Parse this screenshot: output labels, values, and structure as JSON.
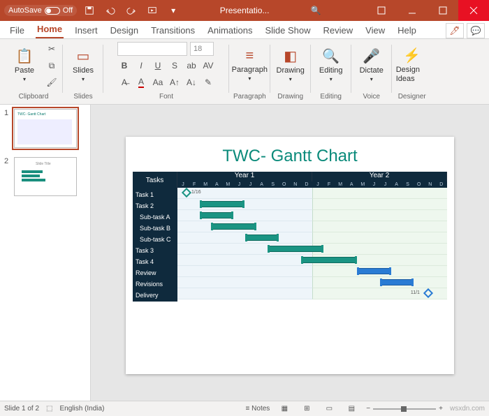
{
  "titlebar": {
    "autosave_label": "AutoSave",
    "autosave_state": "Off",
    "doc_title": "Presentatio...",
    "search_icon": "🔍"
  },
  "tabs": {
    "items": [
      "File",
      "Home",
      "Insert",
      "Design",
      "Transitions",
      "Animations",
      "Slide Show",
      "Review",
      "View",
      "Help"
    ],
    "active_index": 1
  },
  "ribbon": {
    "clipboard": {
      "label": "Clipboard",
      "paste": "Paste"
    },
    "slides": {
      "label": "Slides",
      "btn": "Slides"
    },
    "font": {
      "label": "Font",
      "name_placeholder": "",
      "size_placeholder": "18"
    },
    "paragraph": {
      "label": "Paragraph",
      "btn": "Paragraph"
    },
    "drawing": {
      "label": "Drawing",
      "btn": "Drawing"
    },
    "editing": {
      "label": "Editing",
      "btn": "Editing"
    },
    "voice": {
      "label": "Voice",
      "btn": "Dictate"
    },
    "designer": {
      "label": "Designer",
      "btn": "Design Ideas"
    }
  },
  "status": {
    "slide_info": "Slide 1 of 2",
    "language": "English (India)",
    "notes": "Notes",
    "zoom": "58%",
    "watermark": "wsxdn.com"
  },
  "slide": {
    "title": "TWC- Gantt Chart"
  },
  "chart_data": {
    "type": "gantt",
    "title": "TWC- Gantt Chart",
    "columns_header": "Tasks",
    "year_labels": [
      "Year 1",
      "Year 2"
    ],
    "months": [
      "J",
      "F",
      "M",
      "A",
      "M",
      "J",
      "J",
      "A",
      "S",
      "O",
      "N",
      "D"
    ],
    "milestones": [
      {
        "task_index": 0,
        "month_label": "1/16",
        "month": 0.5
      },
      {
        "task_index": 9,
        "month_label": "11/1",
        "month": 22,
        "color": "blue"
      }
    ],
    "tasks": [
      {
        "name": "Task 1",
        "indent": 0,
        "bar": null
      },
      {
        "name": "Task 2",
        "indent": 0,
        "bar": {
          "start": 2,
          "end": 6,
          "color": "teal"
        }
      },
      {
        "name": "Sub-task A",
        "indent": 1,
        "bar": {
          "start": 2,
          "end": 5,
          "color": "teal"
        }
      },
      {
        "name": "Sub-task B",
        "indent": 1,
        "bar": {
          "start": 3,
          "end": 7,
          "color": "teal"
        }
      },
      {
        "name": "Sub-task C",
        "indent": 1,
        "bar": {
          "start": 6,
          "end": 9,
          "color": "teal"
        }
      },
      {
        "name": "Task 3",
        "indent": 0,
        "bar": {
          "start": 8,
          "end": 13,
          "color": "teal"
        }
      },
      {
        "name": "Task 4",
        "indent": 0,
        "bar": {
          "start": 11,
          "end": 16,
          "color": "teal"
        }
      },
      {
        "name": "Review",
        "indent": 0,
        "bar": {
          "start": 16,
          "end": 19,
          "color": "blue"
        }
      },
      {
        "name": "Revisions",
        "indent": 0,
        "bar": {
          "start": 18,
          "end": 21,
          "color": "blue"
        }
      },
      {
        "name": "Delivery",
        "indent": 0,
        "bar": null
      }
    ]
  },
  "thumbnails": [
    {
      "num": "1",
      "active": true
    },
    {
      "num": "2",
      "active": false
    }
  ]
}
